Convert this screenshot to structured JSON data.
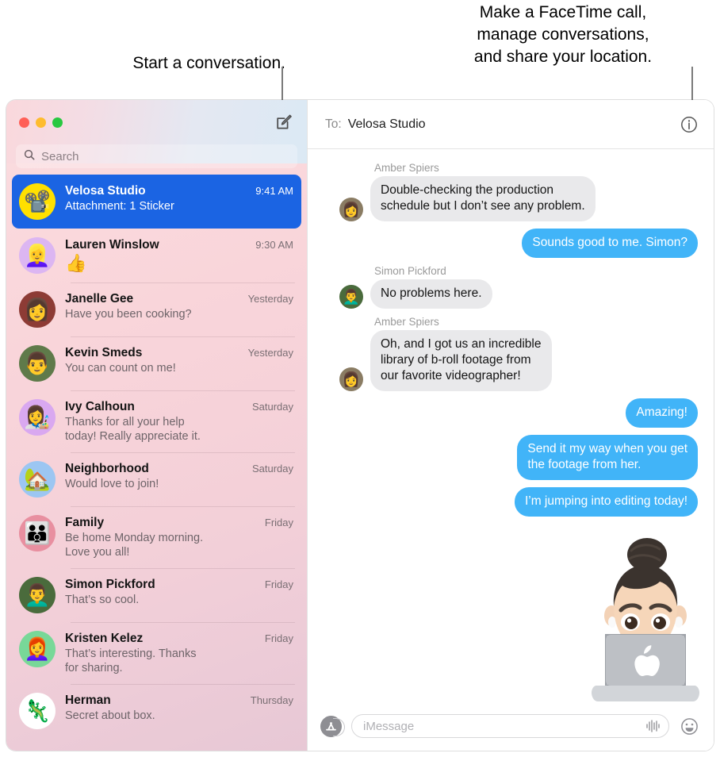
{
  "callouts": {
    "left": "Start a conversation.",
    "right": "Make a FaceTime call,\nmanage conversations,\nand share your location."
  },
  "window": {
    "traffic_lights": [
      "close",
      "minimize",
      "zoom"
    ],
    "compose_icon": "compose-icon"
  },
  "search": {
    "placeholder": "Search",
    "icon": "search-icon"
  },
  "conversations": [
    {
      "name": "Velosa Studio",
      "preview": "Attachment: 1 Sticker",
      "time": "9:41 AM",
      "avatar_glyph": "📽️",
      "avatar_bg": "#ffe000",
      "selected": true,
      "emoji_preview": false
    },
    {
      "name": "Lauren Winslow",
      "preview": "👍",
      "time": "9:30 AM",
      "avatar_glyph": "👱‍♀️",
      "avatar_bg": "#dcb6f2",
      "selected": false,
      "emoji_preview": true
    },
    {
      "name": "Janelle Gee",
      "preview": "Have you been cooking?",
      "time": "Yesterday",
      "avatar_glyph": "👩",
      "avatar_bg": "#8d3b35",
      "selected": false,
      "emoji_preview": false
    },
    {
      "name": "Kevin Smeds",
      "preview": "You can count on me!",
      "time": "Yesterday",
      "avatar_glyph": "👨",
      "avatar_bg": "#5f7a4a",
      "selected": false,
      "emoji_preview": false
    },
    {
      "name": "Ivy Calhoun",
      "preview": "Thanks for all your help\ntoday! Really appreciate it.",
      "time": "Saturday",
      "avatar_glyph": "👩‍🎨",
      "avatar_bg": "#d9a8f0",
      "selected": false,
      "emoji_preview": false
    },
    {
      "name": "Neighborhood",
      "preview": "Would love to join!",
      "time": "Saturday",
      "avatar_glyph": "🏡",
      "avatar_bg": "#9cc6f2",
      "selected": false,
      "emoji_preview": false
    },
    {
      "name": "Family",
      "preview": "Be home Monday morning.\nLove you all!",
      "time": "Friday",
      "avatar_glyph": "👪",
      "avatar_bg": "#e88fa0",
      "selected": false,
      "emoji_preview": false
    },
    {
      "name": "Simon Pickford",
      "preview": "That’s so cool.",
      "time": "Friday",
      "avatar_glyph": "👨‍🦱",
      "avatar_bg": "#4a6b3c",
      "selected": false,
      "emoji_preview": false
    },
    {
      "name": "Kristen Kelez",
      "preview": "That’s interesting. Thanks\nfor sharing.",
      "time": "Friday",
      "avatar_glyph": "👩‍🦰",
      "avatar_bg": "#78d898",
      "selected": false,
      "emoji_preview": false
    },
    {
      "name": "Herman",
      "preview": "Secret about box.",
      "time": "Thursday",
      "avatar_glyph": "🦎",
      "avatar_bg": "#ffffff",
      "selected": false,
      "emoji_preview": false
    }
  ],
  "conversation_header": {
    "to_label": "To:",
    "to_value": "Velosa Studio",
    "info_icon": "info-icon"
  },
  "messages": [
    {
      "direction": "incoming",
      "sender": "Amber Spiers",
      "text": "Double-checking the production\nschedule but I don’t see any problem.",
      "avatar_glyph": "👩",
      "avatar_bg": "#8a7c63"
    },
    {
      "direction": "outgoing",
      "sender": "",
      "text": "Sounds good to me. Simon?",
      "tail": true
    },
    {
      "direction": "incoming",
      "sender": "Simon Pickford",
      "text": "No problems here.",
      "avatar_glyph": "👨‍🦱",
      "avatar_bg": "#4a6b3c"
    },
    {
      "direction": "incoming",
      "sender": "Amber Spiers",
      "text": "Oh, and I got us an incredible\nlibrary of b-roll footage from\nour favorite videographer!",
      "avatar_glyph": "👩",
      "avatar_bg": "#8a7c63"
    },
    {
      "direction": "outgoing",
      "sender": "",
      "text": "Amazing!",
      "tail": false
    },
    {
      "direction": "outgoing",
      "sender": "",
      "text": "Send it my way when you get\nthe footage from her.",
      "tail": false
    },
    {
      "direction": "outgoing",
      "sender": "",
      "text": "I’m jumping into editing today!",
      "tail": true
    }
  ],
  "sticker": {
    "name": "memoji-laptop-sticker",
    "description": "Memoji with hair bun behind a laptop"
  },
  "input_bar": {
    "apps_icon": "app-store-icon",
    "placeholder": "iMessage",
    "audio_icon": "audio-waveform-icon",
    "emoji_icon": "emoji-smiley-icon"
  },
  "colors": {
    "selected_row": "#1b64e3",
    "outgoing_bubble": "#41b4f8",
    "incoming_bubble": "#e9e9eb",
    "traffic_red": "#ff5f57",
    "traffic_yellow": "#febc2e",
    "traffic_green": "#28c840"
  }
}
